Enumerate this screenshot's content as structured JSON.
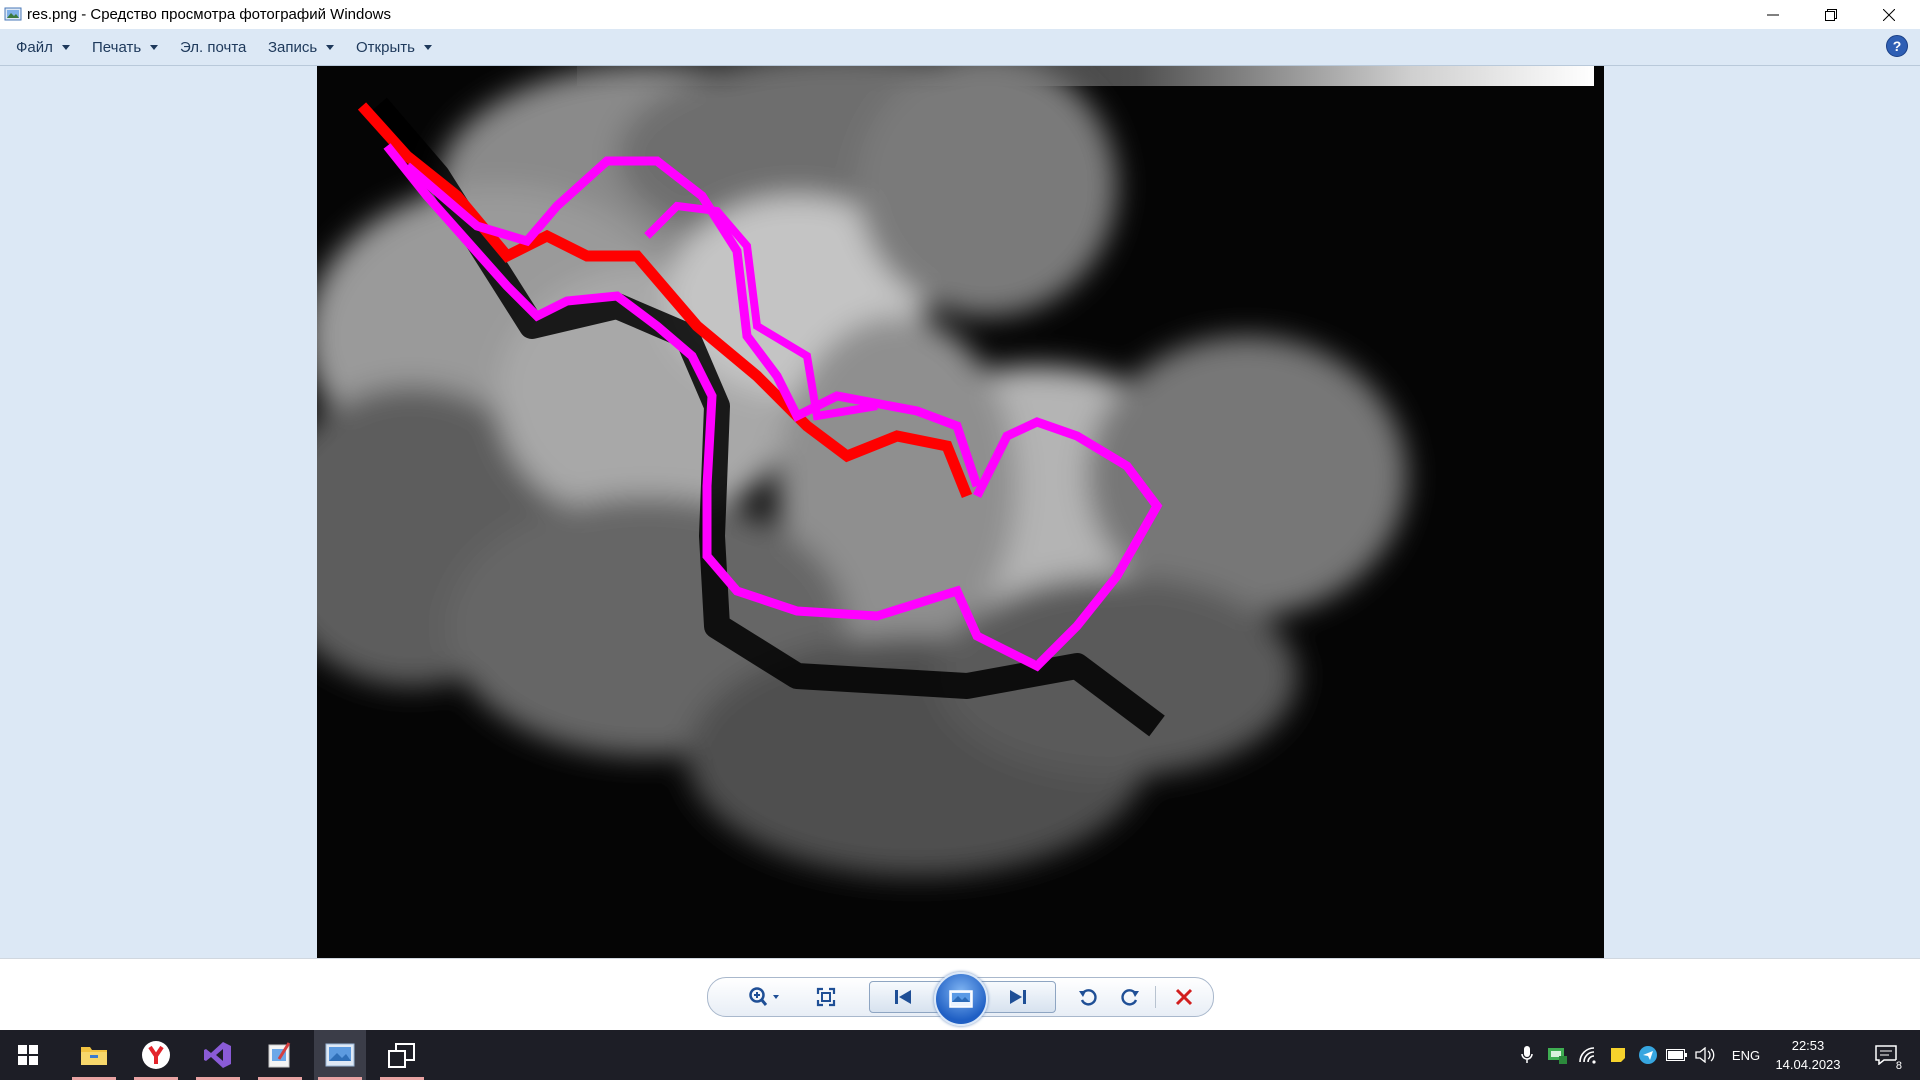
{
  "window": {
    "title": "res.png - Средство просмотра фотографий Windows",
    "minimize_icon": "minimize-icon",
    "maximize_icon": "restore-icon",
    "close_icon": "close-icon"
  },
  "menu": {
    "items": [
      {
        "label": "Файл",
        "has_dropdown": true
      },
      {
        "label": "Печать",
        "has_dropdown": true
      },
      {
        "label": "Эл. почта",
        "has_dropdown": false
      },
      {
        "label": "Запись",
        "has_dropdown": true
      },
      {
        "label": "Открыть",
        "has_dropdown": true
      }
    ],
    "help_label": "?"
  },
  "image": {
    "filename": "res.png",
    "colors": {
      "path_red": "#ff0000",
      "path_magenta": "#ff00ff",
      "background": "#050505"
    }
  },
  "controls": {
    "zoom_icon": "zoom-icon",
    "fit_icon": "actual-size-icon",
    "prev_icon": "previous-icon",
    "slideshow_icon": "slideshow-icon",
    "next_icon": "next-icon",
    "rotate_ccw_icon": "rotate-counterclockwise-icon",
    "rotate_cw_icon": "rotate-clockwise-icon",
    "delete_icon": "delete-icon"
  },
  "taskbar": {
    "apps": [
      {
        "name": "file-explorer-icon"
      },
      {
        "name": "yandex-browser-icon"
      },
      {
        "name": "visual-studio-icon"
      },
      {
        "name": "paint-icon"
      },
      {
        "name": "photo-viewer-icon"
      },
      {
        "name": "task-view-icon"
      }
    ],
    "language": "ENG",
    "time": "22:53",
    "date": "14.04.2023",
    "notification_count": "8"
  }
}
